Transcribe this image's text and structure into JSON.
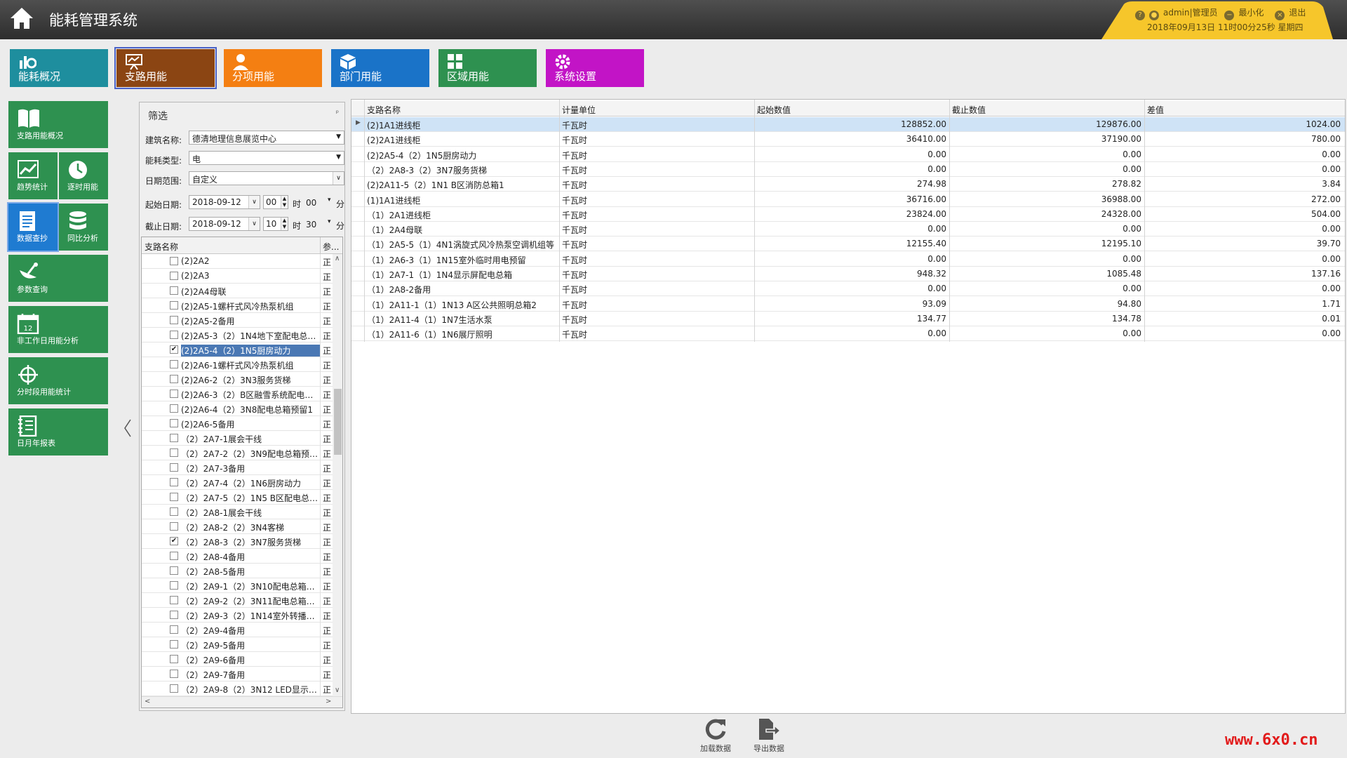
{
  "app": {
    "title": "能耗管理系统"
  },
  "user": {
    "name": "admin|管理员",
    "minimize": "最小化",
    "exit": "退出",
    "datetime": "2018年09月13日  11时00分25秒  星期四"
  },
  "topnav": [
    {
      "label": "能耗概况",
      "icon": "bar-chart-icon",
      "color": "#1e8e9e"
    },
    {
      "label": "支路用能",
      "icon": "presentation-chart-icon",
      "color": "#8b4513"
    },
    {
      "label": "分项用能",
      "icon": "person-icon",
      "color": "#f47f12"
    },
    {
      "label": "部门用能",
      "icon": "cube-icon",
      "color": "#1a73c8"
    },
    {
      "label": "区域用能",
      "icon": "grid-icon",
      "color": "#2e9150"
    },
    {
      "label": "系统设置",
      "icon": "gear-icon",
      "color": "#c214c6"
    }
  ],
  "sidenav": [
    {
      "label": "支路用能概况",
      "icon": "book-icon"
    },
    {
      "label": "趋势统计",
      "icon": "trend-icon"
    },
    {
      "label": "逐时用能",
      "icon": "clock-icon"
    },
    {
      "label": "数据查抄",
      "icon": "document-icon"
    },
    {
      "label": "同比分析",
      "icon": "database-icon"
    },
    {
      "label": "参数查询",
      "icon": "satellite-icon"
    },
    {
      "label": "非工作日用能分析",
      "icon": "calendar-icon"
    },
    {
      "label": "分时段用能统计",
      "icon": "crosshair-icon"
    },
    {
      "label": "日月年报表",
      "icon": "notebook-icon"
    }
  ],
  "calendar_day": "12",
  "filter": {
    "title": "筛选",
    "building_label": "建筑名称:",
    "building_value": "德清地理信息展览中心",
    "energy_label": "能耗类型:",
    "energy_value": "电",
    "range_label": "日期范围:",
    "range_value": "自定义",
    "start_label": "起始日期:",
    "start_date": "2018-09-12",
    "start_hour": "00",
    "start_min": "00",
    "end_label": "截止日期:",
    "end_date": "2018-09-12",
    "end_hour": "10",
    "end_min": "30",
    "unit_hour": "时",
    "unit_min": "分"
  },
  "tree": {
    "col_name": "支路名称",
    "col_param": "参...",
    "rows": [
      {
        "name": "(2)2A2",
        "checked": false,
        "status": "正"
      },
      {
        "name": "(2)2A3",
        "checked": false,
        "status": "正"
      },
      {
        "name": "(2)2A4母联",
        "checked": false,
        "status": "正"
      },
      {
        "name": "(2)2A5-1螺杆式风冷热泵机组",
        "checked": false,
        "status": "正"
      },
      {
        "name": "(2)2A5-2备用",
        "checked": false,
        "status": "正"
      },
      {
        "name": "(2)2A5-3（2）1N4地下室配电总箱4",
        "checked": false,
        "status": "正"
      },
      {
        "name": "(2)2A5-4（2）1N5厨房动力",
        "checked": true,
        "status": "正",
        "highlight": true
      },
      {
        "name": "(2)2A6-1螺杆式风冷热泵机组",
        "checked": false,
        "status": "正"
      },
      {
        "name": "(2)2A6-2（2）3N3服务货梯",
        "checked": false,
        "status": "正"
      },
      {
        "name": "(2)2A6-3（2）B区融雪系统配电总箱",
        "checked": false,
        "status": "正"
      },
      {
        "name": "(2)2A6-4（2）3N8配电总箱预留1",
        "checked": false,
        "status": "正"
      },
      {
        "name": "(2)2A6-5备用",
        "checked": false,
        "status": "正"
      },
      {
        "name": "（2）2A7-1展会干线",
        "checked": false,
        "status": "正"
      },
      {
        "name": "（2）2A7-2（2）3N9配电总箱预留2",
        "checked": false,
        "status": "正"
      },
      {
        "name": "（2）2A7-3备用",
        "checked": false,
        "status": "正"
      },
      {
        "name": "（2）2A7-4（2）1N6厨房动力",
        "checked": false,
        "status": "正"
      },
      {
        "name": "（2）2A7-5（2）1N5 B区配电总箱3",
        "checked": false,
        "status": "正"
      },
      {
        "name": "（2）2A8-1展会干线",
        "checked": false,
        "status": "正"
      },
      {
        "name": "（2）2A8-2（2）3N4客梯",
        "checked": false,
        "status": "正"
      },
      {
        "name": "（2）2A8-3（2）3N7服务货梯",
        "checked": true,
        "status": "正"
      },
      {
        "name": "（2）2A8-4备用",
        "checked": false,
        "status": "正"
      },
      {
        "name": "（2）2A8-5备用",
        "checked": false,
        "status": "正"
      },
      {
        "name": "（2）2A9-1（2）3N10配电总箱预...",
        "checked": false,
        "status": "正"
      },
      {
        "name": "（2）2A9-2（2）3N11配电总箱预...",
        "checked": false,
        "status": "正"
      },
      {
        "name": "（2）2A9-3（2）1N14室外转播配电",
        "checked": false,
        "status": "正"
      },
      {
        "name": "（2）2A9-4备用",
        "checked": false,
        "status": "正"
      },
      {
        "name": "（2）2A9-5备用",
        "checked": false,
        "status": "正"
      },
      {
        "name": "（2）2A9-6备用",
        "checked": false,
        "status": "正"
      },
      {
        "name": "（2）2A9-7备用",
        "checked": false,
        "status": "正"
      },
      {
        "name": "（2）2A9-8（2）3N12 LED显示屏...",
        "checked": false,
        "status": "正"
      }
    ]
  },
  "grid": {
    "headers": [
      "支路名称",
      "计量单位",
      "起始数值",
      "截止数值",
      "差值"
    ],
    "rows": [
      [
        "(2)1A1进线柜",
        "千瓦时",
        "128852.00",
        "129876.00",
        "1024.00"
      ],
      [
        "(2)2A1进线柜",
        "千瓦时",
        "36410.00",
        "37190.00",
        "780.00"
      ],
      [
        "(2)2A5-4（2）1N5厨房动力",
        "千瓦时",
        "0.00",
        "0.00",
        "0.00"
      ],
      [
        "（2）2A8-3（2）3N7服务货梯",
        "千瓦时",
        "0.00",
        "0.00",
        "0.00"
      ],
      [
        "(2)2A11-5（2）1N1 B区消防总箱1",
        "千瓦时",
        "274.98",
        "278.82",
        "3.84"
      ],
      [
        "(1)1A1进线柜",
        "千瓦时",
        "36716.00",
        "36988.00",
        "272.00"
      ],
      [
        "（1）2A1进线柜",
        "千瓦时",
        "23824.00",
        "24328.00",
        "504.00"
      ],
      [
        "（1）2A4母联",
        "千瓦时",
        "0.00",
        "0.00",
        "0.00"
      ],
      [
        "（1）2A5-5（1）4N1涡旋式风冷热泵空调机组等",
        "千瓦时",
        "12155.40",
        "12195.10",
        "39.70"
      ],
      [
        "（1）2A6-3（1）1N15室外临时用电预留",
        "千瓦时",
        "0.00",
        "0.00",
        "0.00"
      ],
      [
        "（1）2A7-1（1）1N4显示屏配电总箱",
        "千瓦时",
        "948.32",
        "1085.48",
        "137.16"
      ],
      [
        "（1）2A8-2备用",
        "千瓦时",
        "0.00",
        "0.00",
        "0.00"
      ],
      [
        "（1）2A11-1（1）1N13 A区公共照明总箱2",
        "千瓦时",
        "93.09",
        "94.80",
        "1.71"
      ],
      [
        "（1）2A11-4（1）1N7生活水泵",
        "千瓦时",
        "134.77",
        "134.78",
        "0.01"
      ],
      [
        "（1）2A11-6（1）1N6展厅照明",
        "千瓦时",
        "0.00",
        "0.00",
        "0.00"
      ]
    ]
  },
  "actions": {
    "load": "加载数据",
    "export": "导出数据"
  },
  "watermark": "www.6x0.cn"
}
